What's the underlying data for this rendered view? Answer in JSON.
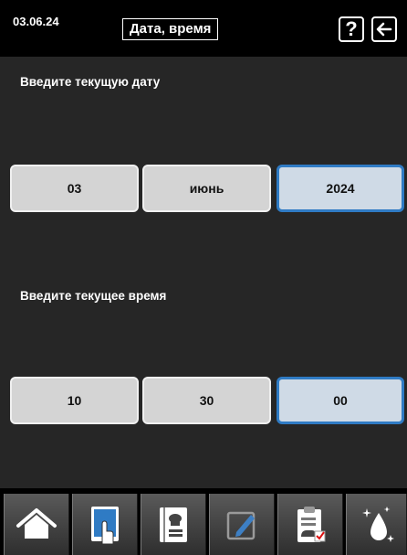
{
  "header": {
    "date": "03.06.24",
    "title": "Дата, время",
    "help_label": "?"
  },
  "date_section": {
    "label": "Введите текущую дату",
    "day": "03",
    "month": "июнь",
    "year": "2024"
  },
  "time_section": {
    "label": "Введите текущее время",
    "hours": "10",
    "minutes": "30",
    "seconds": "00"
  },
  "nav": {
    "items": [
      {
        "icon": "home-icon"
      },
      {
        "icon": "touch-icon"
      },
      {
        "icon": "recipe-book-icon"
      },
      {
        "icon": "edit-pencil-icon"
      },
      {
        "icon": "haccp-clipboard-icon"
      },
      {
        "icon": "cleaning-drop-icon"
      }
    ]
  },
  "colors": {
    "background": "#000000",
    "panel": "#262626",
    "button": "#d4d4d4",
    "active_border": "#2f7bc4"
  }
}
